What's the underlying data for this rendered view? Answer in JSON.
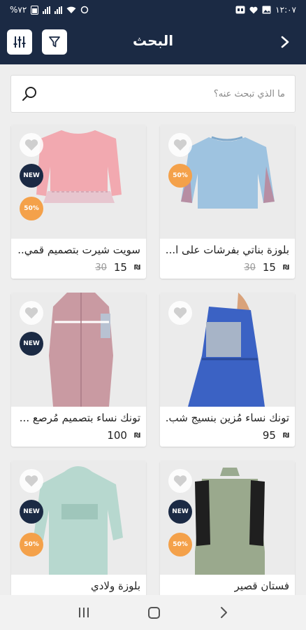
{
  "status_bar": {
    "battery": "%٧٢",
    "time": "١٢:٠٧"
  },
  "header": {
    "title": "البحث"
  },
  "search": {
    "placeholder": "ما الذي تبحث عنه؟"
  },
  "labels": {
    "new": "NEW",
    "discount": "50%"
  },
  "products": [
    {
      "name": "بلوزة بناتي بفرشات على ا...",
      "price": "15",
      "old_price": "30",
      "currency": "₪",
      "is_new": false,
      "discount": true
    },
    {
      "name": "سويت شيرت بتصميم قمي...",
      "price": "15",
      "old_price": "30",
      "currency": "₪",
      "is_new": true,
      "discount": true
    },
    {
      "name": "تونك نساء مُزين بنسيج شب...",
      "price": "95",
      "old_price": "",
      "currency": "₪",
      "is_new": false,
      "discount": false
    },
    {
      "name": "تونك نساء بتصميم مُرصع ...",
      "price": "100",
      "old_price": "",
      "currency": "₪",
      "is_new": true,
      "discount": false
    },
    {
      "name": "فستان قصير",
      "price": "",
      "old_price": "",
      "currency": "",
      "is_new": true,
      "discount": true
    },
    {
      "name": "بلوزة ولادي",
      "price": "",
      "old_price": "",
      "currency": "",
      "is_new": true,
      "discount": true
    }
  ]
}
